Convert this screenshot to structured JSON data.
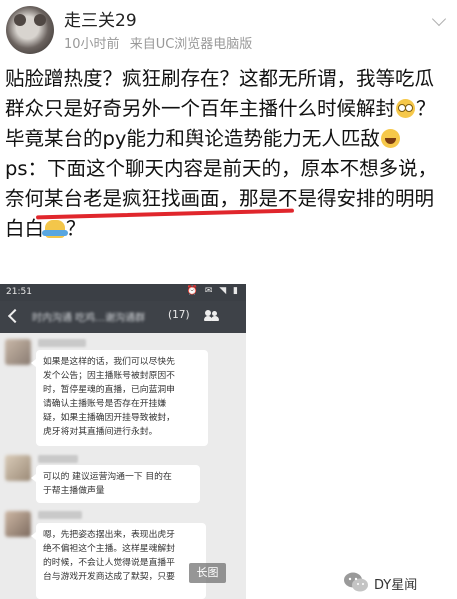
{
  "user": {
    "name": "走三关29"
  },
  "meta": {
    "time": "10小时前",
    "source": "来自UC浏览器电脑版"
  },
  "post": {
    "line1": "贴脸蹭热度？疯狂刷存在？这都无所谓，我等吃瓜群众只是好奇另外一个百年主播什么时候解封",
    "line2": "？毕竟某台的py能力和舆论造势能力无人匹敌",
    "ps_prefix": "ps：",
    "ps_underlined": "下面这个聊天内容是前天的",
    "ps_rest": "，原本不想多说，奈何某台老是疯狂找画面，那是不是得安排的明明白白",
    "ps_end": "？",
    "emojis": [
      "eyes-emoji",
      "laughing-emoji",
      "shrug-emoji"
    ]
  },
  "screenshot": {
    "status_time": "21:51",
    "chat_title": "时内沟通 吃鸡…谢沟通群",
    "member_count": "(17)",
    "messages": [
      {
        "lines": [
          "如果是这样的话，我们可以尽快先",
          "发个公告；因主播账号被封原因不",
          "时，暂停星魂的直播，已向蓝洞申",
          "请确认主播账号是否存在开挂嫌",
          "疑，如果主播确因开挂导致被封，",
          "虎牙将对其直播间进行永封。"
        ]
      },
      {
        "lines": [
          "可以的 建议运营沟通一下 目的在",
          "于帮主播做声量"
        ]
      },
      {
        "lines": [
          "嗯，先把姿态摆出来，表现出虎牙",
          "绝不偏袒这个主播。这样星魂解封",
          "的时候，不会让人觉得说是直播平",
          "台与游戏开发商达成了默契，只要"
        ]
      }
    ],
    "long_image_label": "长图"
  },
  "watermark": {
    "text": "DY星闻"
  },
  "colors": {
    "underline": "#e0262c",
    "chat_header": "#3e4248",
    "chat_bg": "#ebebeb"
  }
}
